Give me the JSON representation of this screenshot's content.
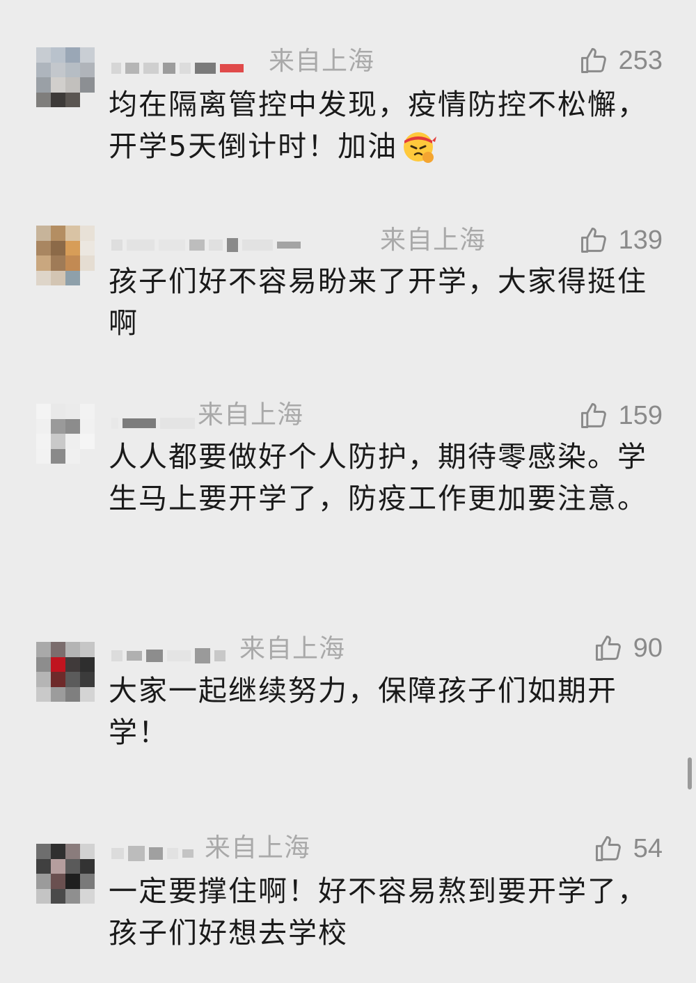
{
  "comments": [
    {
      "location": "来自上海",
      "likes": "253",
      "text": "均在隔离管控中发现，疫情防控不松懈，开学5天倒计时！加油",
      "emoji": "angry-face-with-headband"
    },
    {
      "location": "来自上海",
      "likes": "139",
      "text": "孩子们好不容易盼来了开学，大家得挺住啊"
    },
    {
      "location": "来自上海",
      "likes": "159",
      "text": "人人都要做好个人防护，期待零感染。学生马上要开学了，防疫工作更加要注意。"
    },
    {
      "location": "来自上海",
      "likes": "90",
      "text": "大家一起继续努力，保障孩子们如期开学！"
    },
    {
      "location": "来自上海",
      "likes": "54",
      "text": "一定要撑住啊！好不容易熬到要开学了，孩子们好想去学校"
    }
  ],
  "icons": {
    "like": "thumbs-up-outline-icon"
  },
  "colors": {
    "background": "#ececec",
    "meta": "#a9a9a9",
    "text": "#1a1a1a"
  }
}
